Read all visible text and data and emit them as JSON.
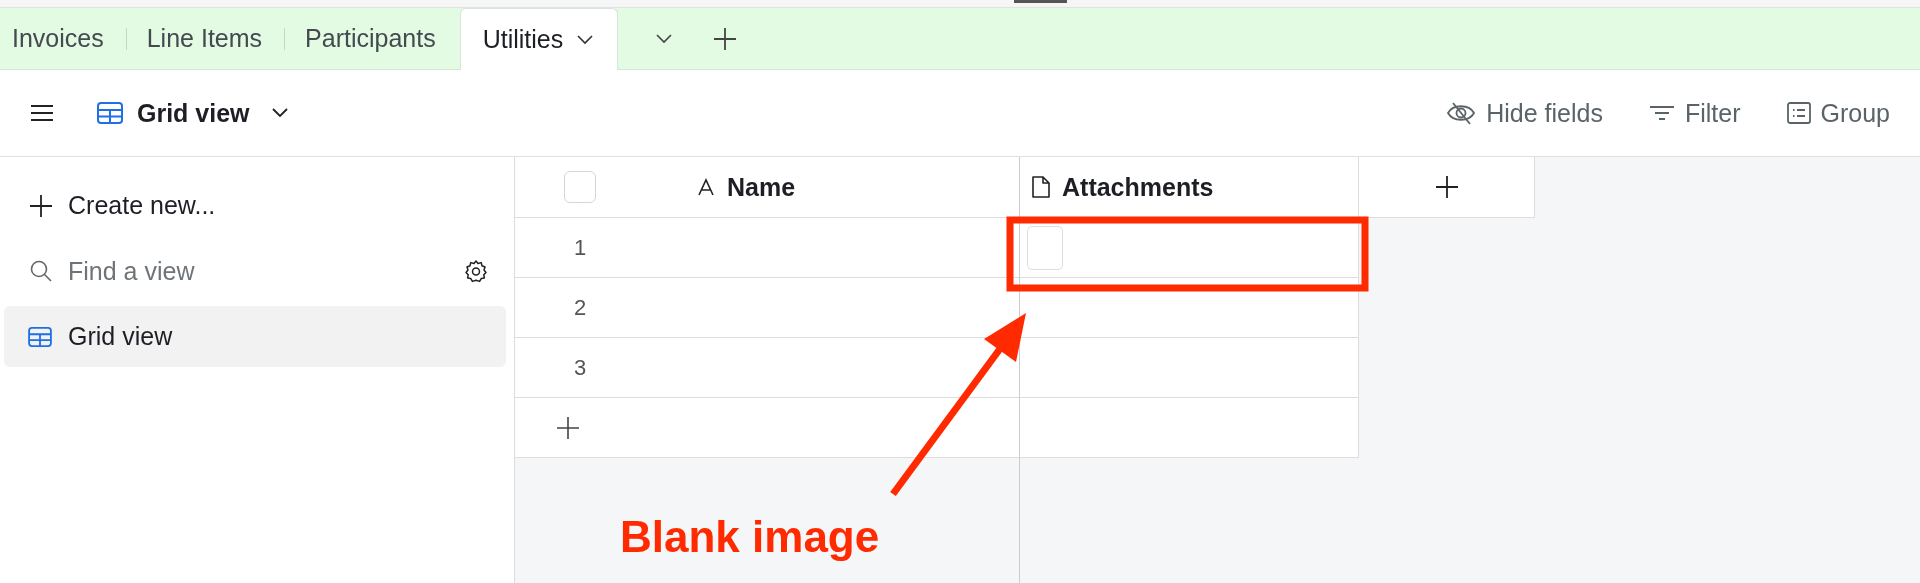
{
  "tabs": [
    {
      "label": "Invoices",
      "selected": false
    },
    {
      "label": "Line Items",
      "selected": false
    },
    {
      "label": "Participants",
      "selected": false
    },
    {
      "label": "Utilities",
      "selected": true
    }
  ],
  "view": {
    "name": "Grid view"
  },
  "toolbar": [
    {
      "label": "Hide fields",
      "kind": "hide"
    },
    {
      "label": "Filter",
      "kind": "filter"
    },
    {
      "label": "Group",
      "kind": "group"
    }
  ],
  "sidebar": {
    "create": "Create new...",
    "search": {
      "placeholder": "Find a view"
    },
    "views": [
      {
        "label": "Grid view",
        "selected": true
      }
    ]
  },
  "table": {
    "select_all": {
      "checked": false
    },
    "columns": [
      {
        "label": "Name",
        "kind": "text"
      },
      {
        "label": "Attachments",
        "kind": "attachment"
      }
    ],
    "rows": [
      {
        "number": "1",
        "blank_thumbnail": true
      },
      {
        "number": "2"
      },
      {
        "number": "3"
      }
    ]
  },
  "annotation": {
    "label": "Blank image"
  }
}
